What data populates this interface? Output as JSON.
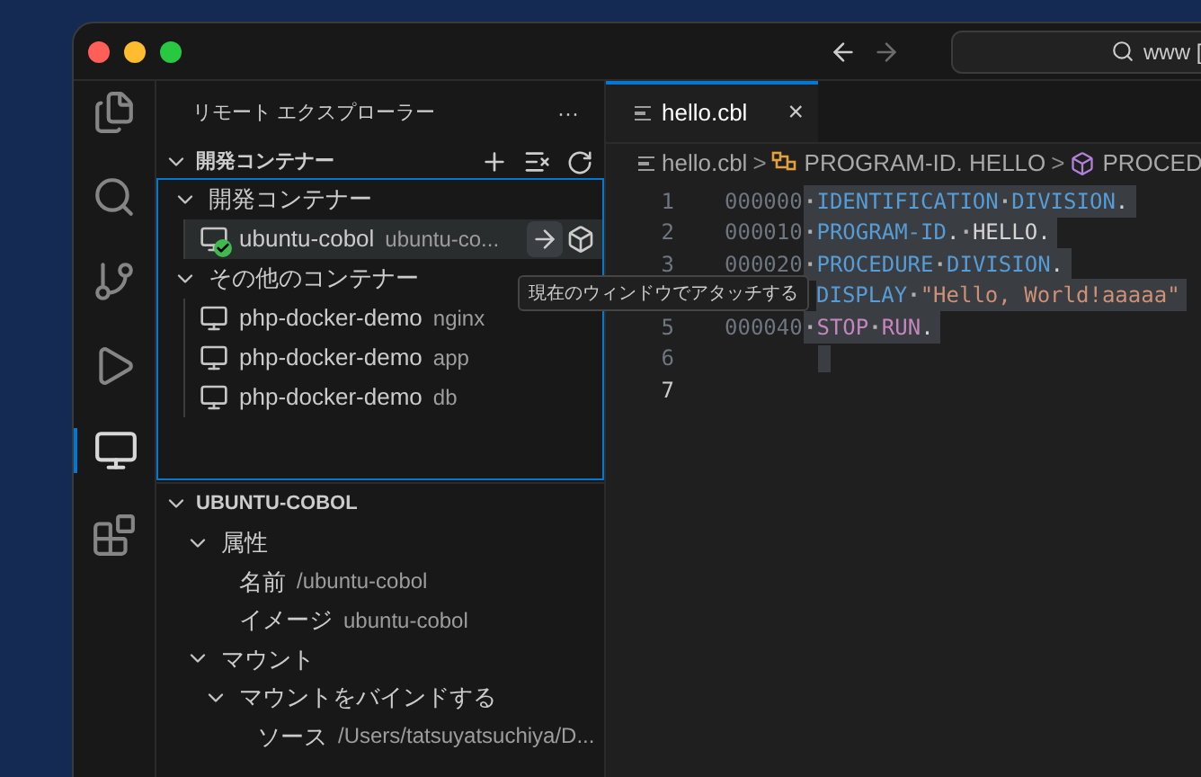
{
  "titlebar": {
    "search": "www ["
  },
  "sidebar": {
    "title": "リモート エクスプローラー",
    "more": "···",
    "section": {
      "title": "開発コンテナー",
      "expanded": true,
      "items": [
        {
          "kind": "group",
          "label": "開発コンテナー",
          "expanded": true,
          "children": [
            {
              "kind": "container",
              "label": "ubuntu-cobol",
              "description": "ubuntu-co...",
              "running": true,
              "selected": true
            }
          ]
        },
        {
          "kind": "group",
          "label": "その他のコンテナー",
          "expanded": true,
          "children": [
            {
              "kind": "container",
              "label": "php-docker-demo",
              "description": "nginx",
              "running": false,
              "selected": false
            },
            {
              "kind": "container",
              "label": "php-docker-demo",
              "description": "app",
              "running": false,
              "selected": false
            },
            {
              "kind": "container",
              "label": "php-docker-demo",
              "description": "db",
              "running": false,
              "selected": false
            }
          ]
        }
      ]
    },
    "tooltip": "現在のウィンドウでアタッチする",
    "details": {
      "title": "UBUNTU-COBOL",
      "expanded": true,
      "items": [
        {
          "label": "属性",
          "expanded": true,
          "children": [
            {
              "label": "名前",
              "value": "/ubuntu-cobol"
            },
            {
              "label": "イメージ",
              "value": "ubuntu-cobol"
            }
          ]
        },
        {
          "label": "マウント",
          "expanded": true,
          "children": [
            {
              "label": "マウントをバインドする",
              "expanded": true,
              "children": [
                {
                  "label": "ソース",
                  "value": "/Users/tatsuyatsuchiya/D..."
                }
              ]
            }
          ]
        }
      ]
    }
  },
  "editor": {
    "tab": {
      "label": "hello.cbl",
      "selected": true,
      "close": "×"
    },
    "breadcrumb": [
      {
        "kind": "file",
        "label": "hello.cbl"
      },
      {
        "kind": "sep",
        "label": ">"
      },
      {
        "kind": "program",
        "label": "PROGRAM-ID. HELLO"
      },
      {
        "kind": "sep",
        "label": ">"
      },
      {
        "kind": "module",
        "label": "PROCED"
      }
    ],
    "lines": [
      {
        "number": "1",
        "seq": "000000",
        "tokens": [
          {
            "kind": "space",
            "text": "·"
          },
          {
            "kind": "keyword",
            "text": "IDENTIFICATION"
          },
          {
            "kind": "space",
            "text": "·"
          },
          {
            "kind": "keyword",
            "text": "DIVISION"
          },
          {
            "kind": "text",
            "text": "."
          }
        ]
      },
      {
        "number": "2",
        "seq": "000010",
        "tokens": [
          {
            "kind": "space",
            "text": "·"
          },
          {
            "kind": "keyword",
            "text": "PROGRAM-ID"
          },
          {
            "kind": "text",
            "text": "."
          },
          {
            "kind": "space",
            "text": "·"
          },
          {
            "kind": "text",
            "text": "HELLO."
          }
        ]
      },
      {
        "number": "3",
        "seq": "000020",
        "tokens": [
          {
            "kind": "space",
            "text": "·"
          },
          {
            "kind": "keyword",
            "text": "PROCEDURE"
          },
          {
            "kind": "space",
            "text": "·"
          },
          {
            "kind": "keyword",
            "text": "DIVISION"
          },
          {
            "kind": "text",
            "text": "."
          }
        ]
      },
      {
        "tokens": [
          {
            "kind": "keyword",
            "text": "DISPLAY"
          },
          {
            "kind": "space",
            "text": "·"
          },
          {
            "kind": "string",
            "text": "\"Hello, World!aaaaa\""
          }
        ]
      },
      {
        "number": "5",
        "seq": "000040",
        "tokens": [
          {
            "kind": "space",
            "text": "·"
          },
          {
            "kind": "control",
            "text": "STOP"
          },
          {
            "kind": "space",
            "text": "·"
          },
          {
            "kind": "control",
            "text": "RUN"
          },
          {
            "kind": "text",
            "text": "."
          }
        ]
      },
      {
        "number": "6"
      },
      {
        "number": "7",
        "current": true
      }
    ]
  }
}
